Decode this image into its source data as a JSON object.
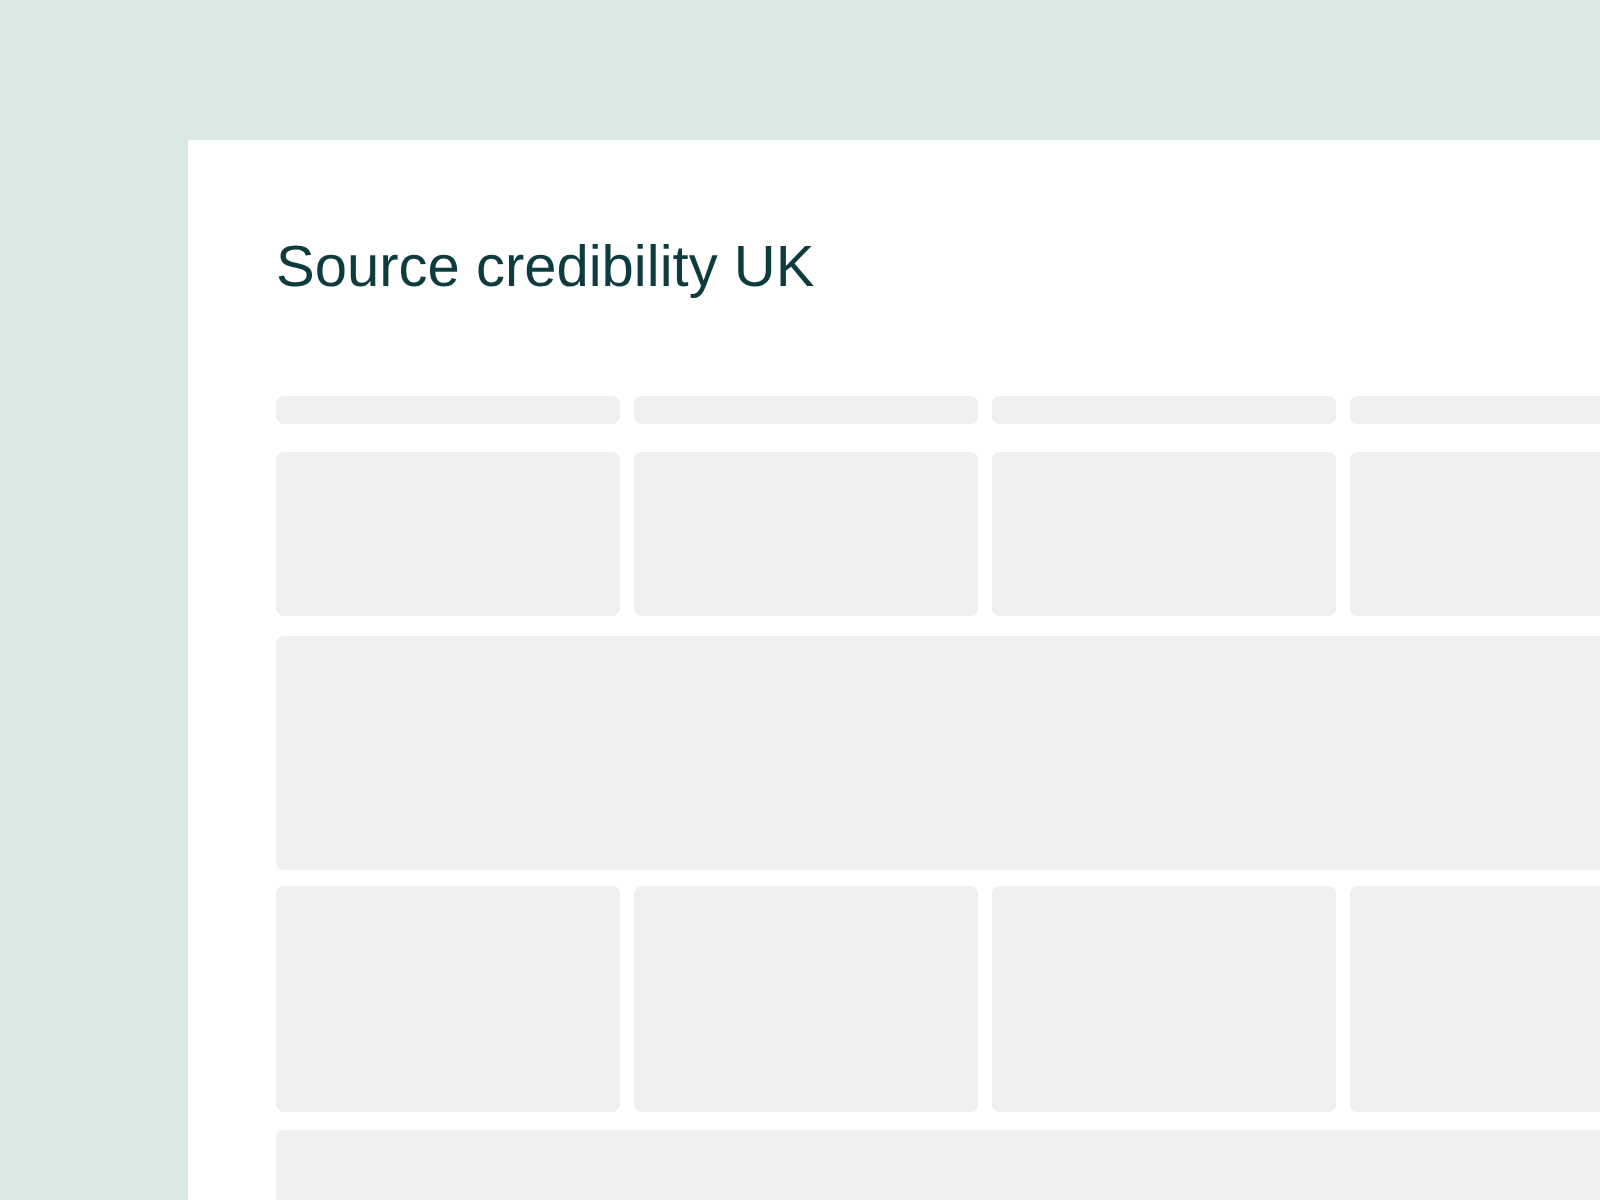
{
  "page": {
    "title": "Source credibility UK"
  }
}
